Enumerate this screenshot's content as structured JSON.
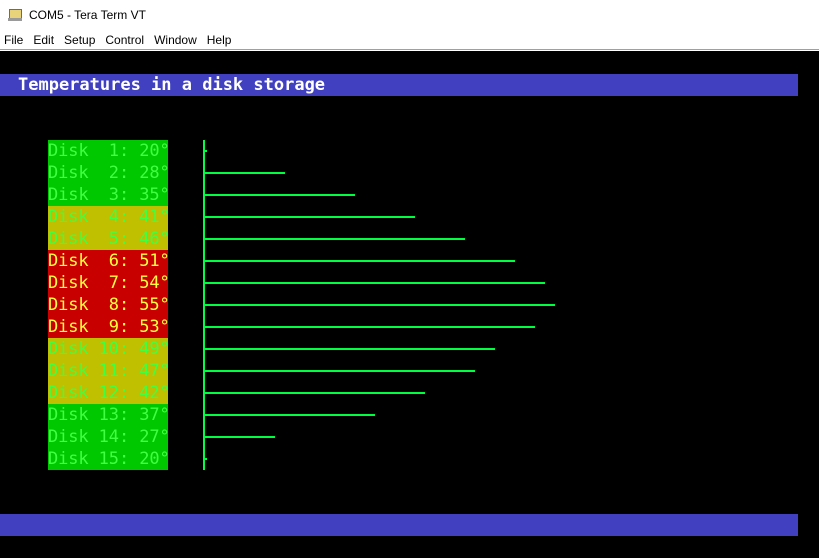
{
  "window": {
    "title": "COM5 - Tera Term VT",
    "icon": "tera-term-icon"
  },
  "menu": [
    "File",
    "Edit",
    "Setup",
    "Control",
    "Window",
    "Help"
  ],
  "terminal": {
    "header": "Temperatures in a disk storage",
    "colors": {
      "background": "#000000",
      "bar_bg": "#4040c0",
      "ok_bg": "#00c800",
      "warm_bg": "#c0c000",
      "hot_bg": "#c80000",
      "line": "#00ff40"
    }
  },
  "disks": [
    {
      "label": "Disk  1: 20°",
      "temp": 20,
      "level": "ok"
    },
    {
      "label": "Disk  2: 28°",
      "temp": 28,
      "level": "ok"
    },
    {
      "label": "Disk  3: 35°",
      "temp": 35,
      "level": "ok"
    },
    {
      "label": "Disk  4: 41°",
      "temp": 41,
      "level": "warm"
    },
    {
      "label": "Disk  5: 46°",
      "temp": 46,
      "level": "warm"
    },
    {
      "label": "Disk  6: 51°",
      "temp": 51,
      "level": "hot"
    },
    {
      "label": "Disk  7: 54°",
      "temp": 54,
      "level": "hot"
    },
    {
      "label": "Disk  8: 55°",
      "temp": 55,
      "level": "hot"
    },
    {
      "label": "Disk  9: 53°",
      "temp": 53,
      "level": "hot"
    },
    {
      "label": "Disk 10: 49°",
      "temp": 49,
      "level": "warm"
    },
    {
      "label": "Disk 11: 47°",
      "temp": 47,
      "level": "warm"
    },
    {
      "label": "Disk 12: 42°",
      "temp": 42,
      "level": "warm"
    },
    {
      "label": "Disk 13: 37°",
      "temp": 37,
      "level": "ok"
    },
    {
      "label": "Disk 14: 27°",
      "temp": 27,
      "level": "ok"
    },
    {
      "label": "Disk 15: 20°",
      "temp": 20,
      "level": "ok"
    }
  ]
}
